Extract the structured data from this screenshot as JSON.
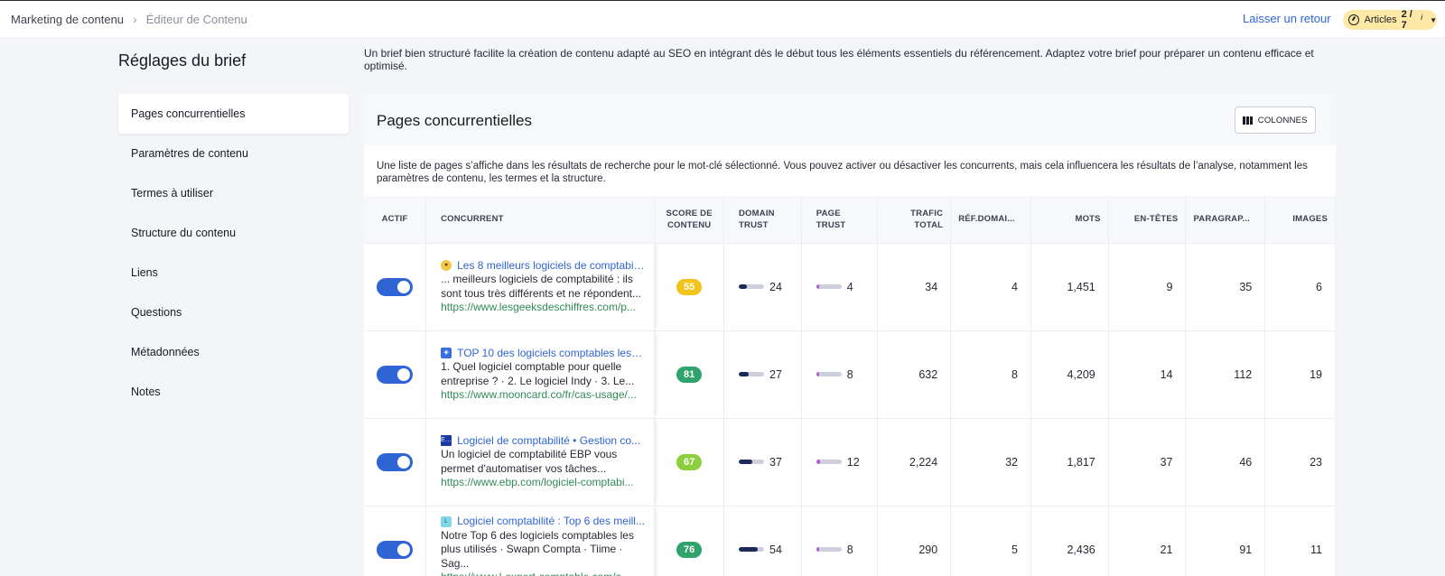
{
  "breadcrumb": {
    "parent": "Marketing de contenu",
    "current": "Éditeur de Contenu"
  },
  "header": {
    "feedback": "Laisser un retour",
    "quota_label": "Articles",
    "quota_value": "2 / 7",
    "quota_info": "i"
  },
  "sidebar": {
    "title": "Réglages du brief",
    "items": [
      {
        "label": "Pages concurrentielles",
        "active": true
      },
      {
        "label": "Paramètres de contenu"
      },
      {
        "label": "Termes à utiliser"
      },
      {
        "label": "Structure du contenu"
      },
      {
        "label": "Liens"
      },
      {
        "label": "Questions"
      },
      {
        "label": "Métadonnées"
      },
      {
        "label": "Notes"
      }
    ]
  },
  "intro": "Un brief bien structuré facilite la création de contenu adapté au SEO en intégrant dès le début tous les éléments essentiels du référencement. Adaptez votre brief pour préparer un contenu efficace et optimisé.",
  "panel": {
    "title": "Pages concurrentielles",
    "columns_button": "COLONNES",
    "description": "Une liste de pages s’affiche dans les résultats de recherche pour le mot-clé sélectionné. Vous pouvez activer ou désactiver les concurrents, mais cela influencera les résultats de l’analyse, notamment les paramètres de contenu, les termes et la structure."
  },
  "table": {
    "headers": {
      "actif": "ACTIF",
      "concurrent": "CONCURRENT",
      "score": [
        "SCORE DE",
        "CONTENU"
      ],
      "domain_trust": [
        "DOMAIN",
        "TRUST"
      ],
      "page_trust": [
        "PAGE",
        "TRUST"
      ],
      "trafic": [
        "TRAFIC",
        "TOTAL"
      ],
      "ref": "RÉF.DOMAI...",
      "mots": "MOTS",
      "entetes": "EN-TÊTES",
      "paragraphes": "PARAGRAP...",
      "images": "IMAGES"
    },
    "rows": [
      {
        "active": true,
        "favicon": "geeks",
        "title": "Les 8 meilleurs logiciels de comptabili...",
        "snippet": "... meilleurs logiciels de comptabilité : ils sont tous très différents et ne répondent...",
        "url": "https://www.lesgeeksdeschiffres.com/p...",
        "score": "55",
        "score_color": "#f2c31b",
        "domain_trust": "24",
        "page_trust": "4",
        "trafic": "34",
        "ref": "4",
        "mots": "1,451",
        "entetes": "9",
        "paragraphes": "35",
        "images": "6"
      },
      {
        "active": true,
        "favicon": "mooncard",
        "title": "TOP 10 des logiciels comptables les pl...",
        "snippet": "1. Quel logiciel comptable pour quelle entreprise ? · 2. Le logiciel Indy · 3. Le...",
        "url": "https://www.mooncard.co/fr/cas-usage/...",
        "score": "81",
        "score_color": "#2fa36b",
        "domain_trust": "27",
        "page_trust": "8",
        "trafic": "632",
        "ref": "8",
        "mots": "4,209",
        "entetes": "14",
        "paragraphes": "112",
        "images": "19"
      },
      {
        "active": true,
        "favicon": "ebp",
        "title": "Logiciel de comptabilité • Gestion co...",
        "snippet": "Un logiciel de comptabilité EBP vous permet d'automatiser vos tâches...",
        "url": "https://www.ebp.com/logiciel-comptabi...",
        "score": "67",
        "score_color": "#8bcf3f",
        "domain_trust": "37",
        "page_trust": "12",
        "trafic": "2,224",
        "ref": "32",
        "mots": "1,817",
        "entetes": "37",
        "paragraphes": "46",
        "images": "23"
      },
      {
        "active": true,
        "favicon": "lexpert",
        "title": "Logiciel comptabilité : Top 6 des meill...",
        "snippet": "Notre Top 6 des logiciels comptables les plus utilisés · Swapn Compta · Tiime · Sag...",
        "url": "https://www.l-expert-comptable.com/a...",
        "score": "76",
        "score_color": "#2fa36b",
        "domain_trust": "54",
        "page_trust": "8",
        "trafic": "290",
        "ref": "5",
        "mots": "2,436",
        "entetes": "21",
        "paragraphes": "91",
        "images": "11"
      }
    ]
  },
  "colors": {
    "accent": "#2f64d4",
    "url_green": "#2f8a55",
    "domain_bar": "#1d2a57",
    "page_bar": "#b65ad6",
    "quota_bg": "#fde8a6"
  }
}
